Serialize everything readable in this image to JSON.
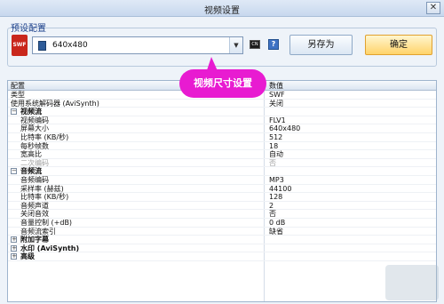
{
  "window": {
    "title": "视频设置",
    "close_glyph": "✕"
  },
  "preset": {
    "group_label": "预设配置",
    "file_icon_label": "SWF",
    "selected_value": "640x480",
    "dropdown_glyph": "▼",
    "cmd_label": "CN",
    "help_label": "?",
    "save_as_label": "另存为",
    "ok_label": "确定"
  },
  "callout": {
    "text": "视频尺寸设置"
  },
  "grid": {
    "headers": {
      "config": "配置",
      "value": "数值"
    },
    "rows": [
      {
        "key": "类型",
        "value": "SWF",
        "level": 0,
        "section": false
      },
      {
        "key": "使用系统解码器 (AviSynth)",
        "value": "关闭",
        "level": 0,
        "section": false
      },
      {
        "key": "视频流",
        "value": "",
        "level": 0,
        "section": true,
        "expander": "−"
      },
      {
        "key": "视频编码",
        "value": "FLV1",
        "level": 1,
        "section": false
      },
      {
        "key": "屏幕大小",
        "value": "640x480",
        "level": 1,
        "section": false
      },
      {
        "key": "比特率 (KB/秒)",
        "value": "512",
        "level": 1,
        "section": false
      },
      {
        "key": "每秒帧数",
        "value": "18",
        "level": 1,
        "section": false
      },
      {
        "key": "宽高比",
        "value": "自动",
        "level": 1,
        "section": false
      },
      {
        "key": "二次编码",
        "value": "否",
        "level": 1,
        "section": false,
        "disabled": true
      },
      {
        "key": "音频流",
        "value": "",
        "level": 0,
        "section": true,
        "expander": "−"
      },
      {
        "key": "音频编码",
        "value": "MP3",
        "level": 1,
        "section": false
      },
      {
        "key": "采样率 (赫兹)",
        "value": "44100",
        "level": 1,
        "section": false
      },
      {
        "key": "比特率 (KB/秒)",
        "value": "128",
        "level": 1,
        "section": false
      },
      {
        "key": "音频声道",
        "value": "2",
        "level": 1,
        "section": false
      },
      {
        "key": "关闭音效",
        "value": "否",
        "level": 1,
        "section": false
      },
      {
        "key": "音量控制 (+dB)",
        "value": "0 dB",
        "level": 1,
        "section": false
      },
      {
        "key": "音频流索引",
        "value": "缺省",
        "level": 1,
        "section": false
      },
      {
        "key": "附加字幕",
        "value": "",
        "level": 0,
        "section": true,
        "expander": "+"
      },
      {
        "key": "水印 (AviSynth)",
        "value": "",
        "level": 0,
        "section": true,
        "expander": "+"
      },
      {
        "key": "高级",
        "value": "",
        "level": 0,
        "section": true,
        "expander": "+"
      }
    ]
  }
}
